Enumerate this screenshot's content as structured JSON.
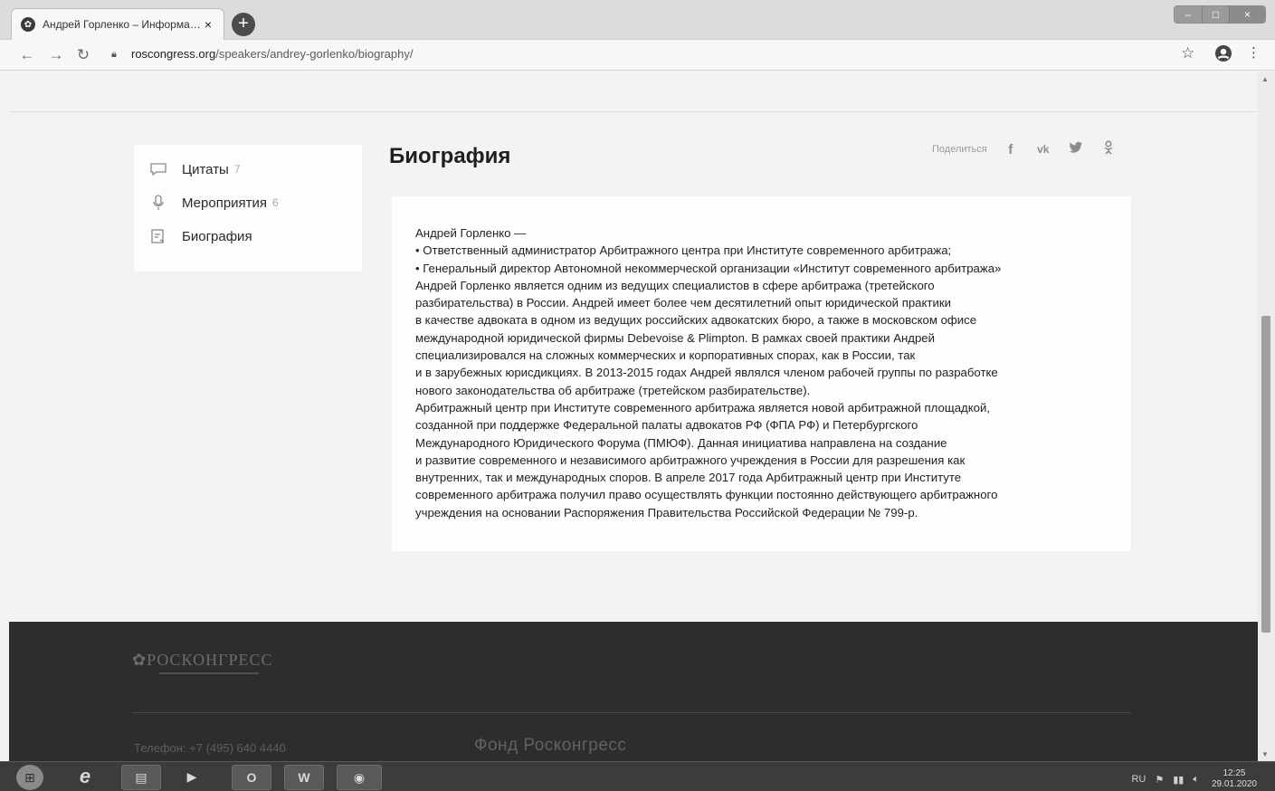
{
  "browser": {
    "tab_title": "Андрей Горленко – Информа…",
    "tab_close": "×",
    "new_tab": "+",
    "url_domain": "roscongress.org",
    "url_path": "/speakers/andrey-gorlenko/biography/",
    "window_controls": [
      "–",
      "□",
      "×"
    ]
  },
  "sidebar": {
    "items": [
      {
        "label": "Цитаты",
        "count": "7",
        "icon": "quote-icon"
      },
      {
        "label": "Мероприятия",
        "count": "6",
        "icon": "microphone-icon"
      },
      {
        "label": "Биография",
        "count": "",
        "icon": "biography-icon"
      }
    ]
  },
  "main": {
    "title": "Биография",
    "share_label": "Поделиться",
    "share_icons": [
      "f",
      "vk",
      "twitter",
      "ok"
    ],
    "bio_lines": [
      "Андрей Горленко —",
      "• Ответственный администратор Арбитражного центра при Институте современного арбитража;",
      "• Генеральный директор Автономной некоммерческой организации «Институт современного арбитража»",
      "Андрей Горленко является одним из ведущих специалистов в сфере арбитража (третейского",
      "разбирательства) в России. Андрей имеет более чем десятилетний опыт юридической практики",
      "в качестве адвоката в одном из ведущих российских адвокатских бюро, а также в московском офисе",
      "международной юридической фирмы Debevoise & Plimpton. В рамках своей практики Андрей",
      "специализировался на сложных коммерческих и корпоративных спорах, как в России, так",
      "и в зарубежных юрисдикциях. В 2013-2015 годах Андрей являлся членом рабочей группы по разработке",
      "нового законодательства об арбитраже (третейском разбирательстве).",
      "Арбитражный центр при Институте современного арбитража является новой арбитражной площадкой,",
      "созданной при поддержке Федеральной палаты адвокатов РФ (ФПА РФ) и Петербургского",
      "Международного Юридического Форума (ПМЮФ). Данная инициатива направлена на создание",
      "и развитие современного и независимого арбитражного учреждения в России для разрешения как",
      "внутренних, так и международных споров. В апреле 2017 года Арбитражный центр при Институте",
      "современного арбитража получил право осуществлять функции постоянно действующего арбитражного",
      "учреждения на основании Распоряжения Правительства Российской Федерации № 799-р."
    ]
  },
  "footer": {
    "logo": "РОСКОНГРЕСС",
    "phone": "Телефон: +7 (495) 640 4440",
    "fund": "Фонд Росконгресс"
  },
  "taskbar": {
    "apps": [
      "e",
      "▤",
      "▶",
      "O",
      "W",
      "◉"
    ],
    "lang": "RU",
    "time": "12:25",
    "date": "29.01.2020"
  },
  "colors": {
    "footer_bg": "#2d2d2d",
    "page_bg": "#f3f3f3",
    "card_bg": "#fefefe"
  }
}
